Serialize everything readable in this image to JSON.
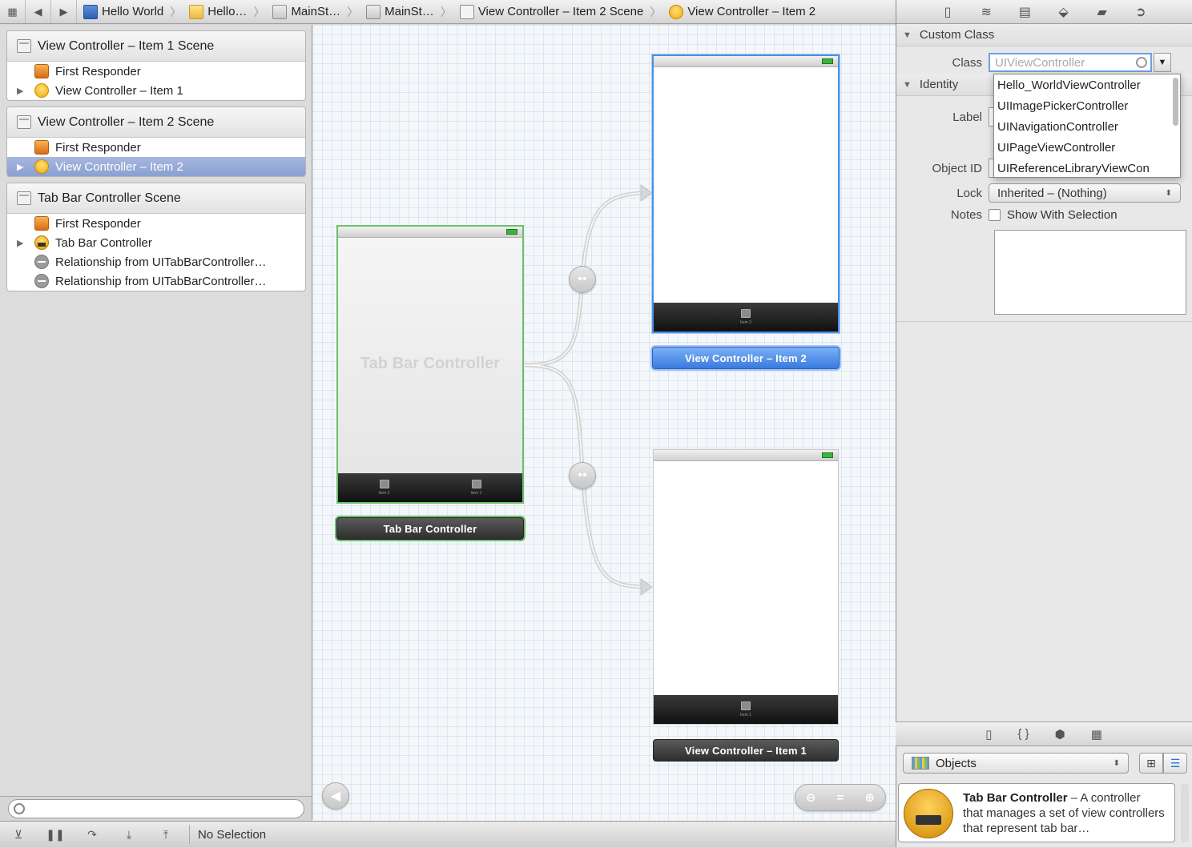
{
  "jumpbar": {
    "crumbs": [
      "Hello World",
      "Hello…",
      "MainSt…",
      "MainSt…",
      "View Controller – Item 2 Scene",
      "View Controller – Item 2"
    ]
  },
  "outline": {
    "scenes": [
      {
        "title": "View Controller – Item 1 Scene",
        "rows": [
          "First Responder",
          "View Controller – Item 1"
        ]
      },
      {
        "title": "View Controller – Item 2 Scene",
        "rows": [
          "First Responder",
          "View Controller – Item 2"
        ]
      },
      {
        "title": "Tab Bar Controller Scene",
        "rows": [
          "First Responder",
          "Tab Bar Controller",
          "Relationship from UITabBarController…",
          "Relationship from UITabBarController…"
        ]
      }
    ]
  },
  "canvas": {
    "tabbar_controller": {
      "watermark": "Tab Bar Controller",
      "label": "Tab Bar Controller",
      "tab_items": [
        "Item 2",
        "Item 1"
      ]
    },
    "vc_item2": {
      "label": "View Controller – Item 2",
      "tab_item": "Item 2"
    },
    "vc_item1": {
      "label": "View Controller – Item 1",
      "tab_item": "Item 1"
    }
  },
  "debugbar": {
    "status": "No Selection"
  },
  "inspector": {
    "custom_class": {
      "header": "Custom Class",
      "class_label": "Class",
      "class_placeholder": "UIViewController",
      "dropdown_options": [
        "Hello_WorldViewController",
        "UIImagePickerController",
        "UINavigationController",
        "UIPageViewController",
        "UIReferenceLibraryViewCon"
      ]
    },
    "identity": {
      "header": "Identity",
      "label_label": "Label",
      "object_id_label": "Object ID",
      "lock_label": "Lock",
      "lock_value": "Inherited – (Nothing)",
      "notes_label": "Notes",
      "show_with_selection": "Show With Selection"
    },
    "library": {
      "filter_value": "Objects",
      "item_title": "Tab Bar Controller",
      "item_desc_lead": " – A controller",
      "item_desc_rest": "that manages a set of view controllers that represent tab bar…"
    }
  }
}
